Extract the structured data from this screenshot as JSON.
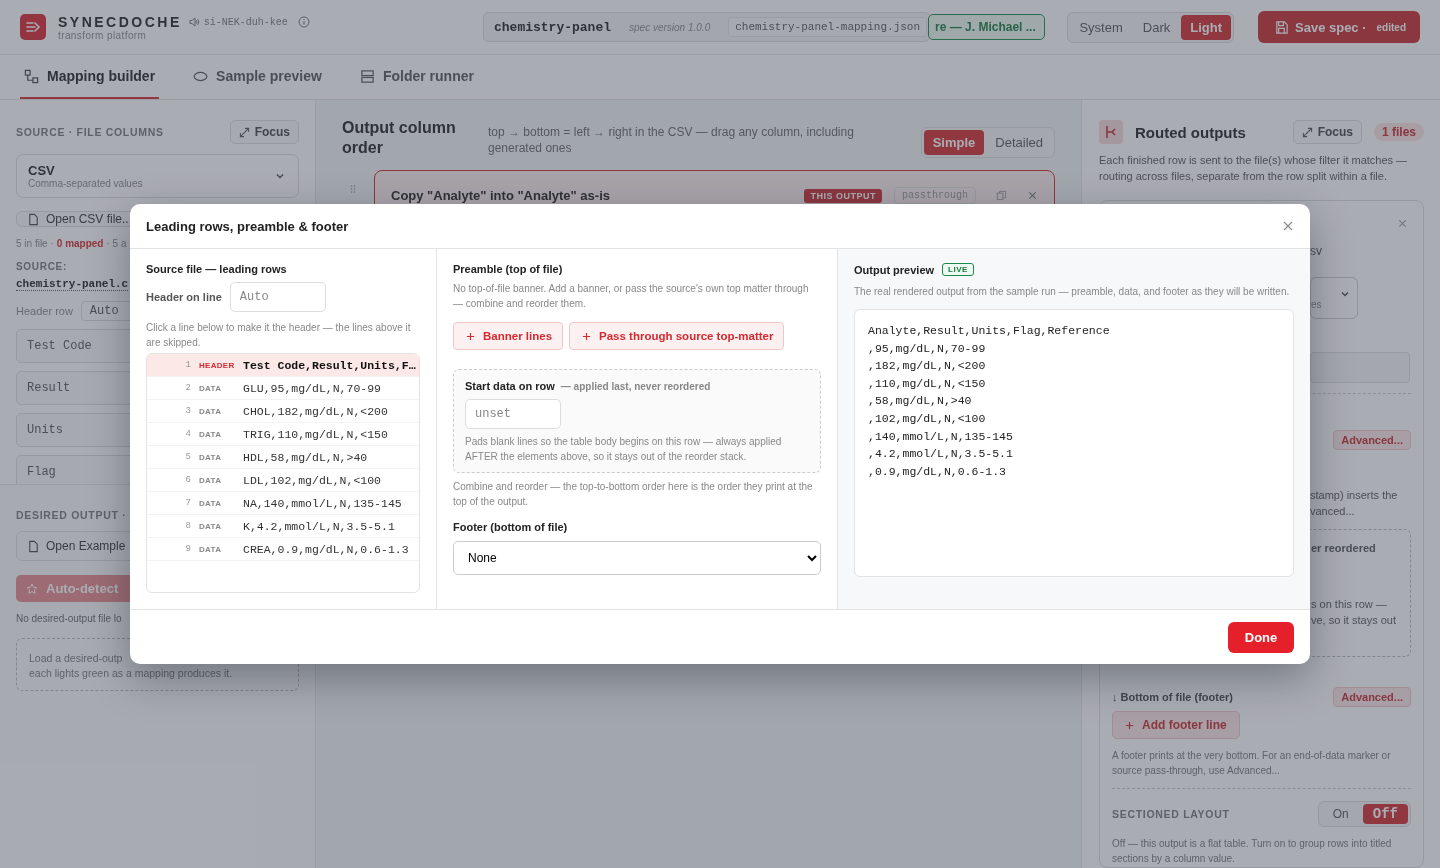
{
  "header": {
    "app_name": "SYNECDOCHE",
    "tagline": "transform platform",
    "pronunciation": "si-NEK-duh-kee",
    "spec_name": "chemistry-panel",
    "spec_version": "spec version 1.0.0",
    "spec_file": "chemistry-panel-mapping.json",
    "author_badge": "re — J. Michael ...",
    "theme_options": [
      {
        "label": "System",
        "selected": false
      },
      {
        "label": "Dark",
        "selected": false
      },
      {
        "label": "Light",
        "selected": true
      }
    ],
    "save_label": "Save spec ·",
    "save_status": "edited"
  },
  "tabs": [
    {
      "label": "Mapping builder",
      "selected": true
    },
    {
      "label": "Sample preview",
      "selected": false
    },
    {
      "label": "Folder runner",
      "selected": false
    }
  ],
  "source_panel": {
    "heading": "SOURCE · FILE COLUMNS",
    "focus_label": "Focus",
    "format_title": "CSV",
    "format_subtitle": "Comma-separated values",
    "open_button": "Open CSV file..",
    "stats_before": "5 in file ·",
    "stats_mapped": "0 mapped",
    "stats_after": "· 5 a",
    "source_label": "SOURCE:",
    "source_file": "chemistry-panel.c",
    "header_row_label": "Header row",
    "header_row_value": "Auto",
    "columns": [
      "Test Code",
      "Result",
      "Units",
      "Flag"
    ],
    "desired_heading": "DESIRED OUTPUT ·",
    "open_example": "Open Example",
    "auto_detect": "Auto-detect",
    "no_file_note": "No desired-output file lo",
    "load_hint_lines": [
      "Load a desired-outp",
      "each lights green as a mapping produces it."
    ]
  },
  "output_order": {
    "title": "Output column order",
    "description": "top → bottom = left → right in the CSV — drag any column, including generated ones",
    "view_modes": [
      {
        "label": "Simple",
        "selected": true
      },
      {
        "label": "Detailed",
        "selected": false
      }
    ],
    "first_rule": {
      "title": "Copy \"Analyte\" into \"Analyte\" as-is",
      "badge": "THIS OUTPUT",
      "tag": "passthrough"
    }
  },
  "routed_outputs": {
    "title": "Routed outputs",
    "focus_label": "Focus",
    "file_count": "1 files",
    "description": "Each finished row is sent to the file(s) whose filter it matches — routing across files, separate from the row split within a file.",
    "file_name_tail": "sv",
    "format_tail": "es",
    "advanced_top": "Advanced...",
    "preamble_note_tail": [
      "stamp) inserts the",
      "vanced..."
    ],
    "start_row_title_tail": "er reordered",
    "start_row_note_tail": [
      "s on this row —",
      "ve, so it stays out"
    ],
    "footer_label": "↓ Bottom of file (footer)",
    "advanced_footer": "Advanced...",
    "add_footer": "Add footer line",
    "footer_note": "A footer prints at the very bottom. For an end-of-data marker or source pass-through, use Advanced...",
    "sectioned_heading": "SECTIONED LAYOUT",
    "sectioned_options": [
      {
        "label": "On",
        "selected": false
      },
      {
        "label": "Off",
        "selected": true
      }
    ],
    "sectioned_note": "Off — this output is a flat table. Turn on to group rows into titled sections by a column value."
  },
  "dialog": {
    "title": "Leading rows, preamble & footer",
    "source": {
      "heading": "Source file — leading rows",
      "header_label": "Header on line",
      "header_placeholder": "Auto",
      "hint": "Click a line below to make it the header — the lines above it are skipped.",
      "lines": [
        {
          "number": "1",
          "tag": "HEADER",
          "text": "Test Code,Result,Units,F…",
          "selected": true
        },
        {
          "number": "2",
          "tag": "DATA",
          "text": "GLU,95,mg/dL,N,70-99",
          "selected": false
        },
        {
          "number": "3",
          "tag": "DATA",
          "text": "CHOL,182,mg/dL,N,<200",
          "selected": false
        },
        {
          "number": "4",
          "tag": "DATA",
          "text": "TRIG,110,mg/dL,N,<150",
          "selected": false
        },
        {
          "number": "5",
          "tag": "DATA",
          "text": "HDL,58,mg/dL,N,>40",
          "selected": false
        },
        {
          "number": "6",
          "tag": "DATA",
          "text": "LDL,102,mg/dL,N,<100",
          "selected": false
        },
        {
          "number": "7",
          "tag": "DATA",
          "text": "NA,140,mmol/L,N,135-145",
          "selected": false
        },
        {
          "number": "8",
          "tag": "DATA",
          "text": "K,4.2,mmol/L,N,3.5-5.1",
          "selected": false
        },
        {
          "number": "9",
          "tag": "DATA",
          "text": "CREA,0.9,mg/dL,N,0.6-1.3",
          "selected": false
        }
      ]
    },
    "preamble": {
      "heading": "Preamble (top of file)",
      "description": "No top-of-file banner. Add a banner, or pass the source's own top matter through — combine and reorder them.",
      "actions": [
        "Banner lines",
        "Pass through source top-matter"
      ],
      "start_title": "Start data on row",
      "start_note": "— applied last, never reordered",
      "start_placeholder": "unset",
      "start_description": "Pads blank lines so the table body begins on this row — always applied AFTER the elements above, so it stays out of the reorder stack.",
      "order_note": "Combine and reorder — the top-to-bottom order here is the order they print at the top of the output.",
      "footer_heading": "Footer (bottom of file)",
      "footer_value": "None"
    },
    "preview": {
      "heading": "Output preview",
      "badge": "LIVE",
      "description": "The real rendered output from the sample run — preamble, data, and footer as they will be written.",
      "lines": [
        "Analyte,Result,Units,Flag,Reference",
        ",95,mg/dL,N,70-99",
        ",182,mg/dL,N,<200",
        ",110,mg/dL,N,<150",
        ",58,mg/dL,N,>40",
        ",102,mg/dL,N,<100",
        ",140,mmol/L,N,135-145",
        ",4.2,mmol/L,N,3.5-5.1",
        ",0.9,mg/dL,N,0.6-1.3"
      ]
    },
    "done_label": "Done"
  }
}
